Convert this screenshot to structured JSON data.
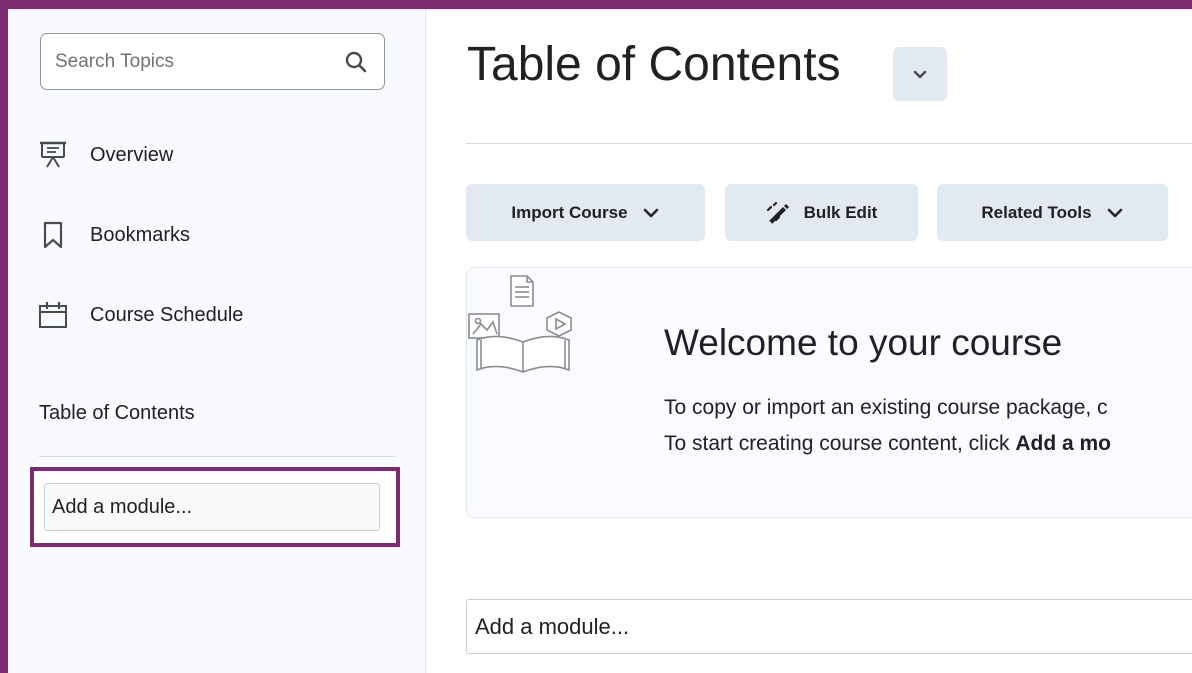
{
  "sidebar": {
    "search": {
      "placeholder": "Search Topics",
      "icon": "search-icon"
    },
    "nav": [
      {
        "label": "Overview",
        "icon": "presentation-icon"
      },
      {
        "label": "Bookmarks",
        "icon": "bookmark-icon"
      },
      {
        "label": "Course Schedule",
        "icon": "calendar-icon"
      }
    ],
    "toc_heading": "Table of Contents",
    "add_module_placeholder": "Add a module..."
  },
  "main": {
    "title": "Table of Contents",
    "toolbar": {
      "import_course": "Import Course",
      "bulk_edit": "Bulk Edit",
      "related_tools": "Related Tools"
    },
    "welcome": {
      "heading": "Welcome to your course",
      "line1": "To copy or import an existing course package, c",
      "line2_prefix": "To start creating course content, click ",
      "line2_bold": "Add a mo"
    },
    "add_module_placeholder": "Add a module..."
  },
  "colors": {
    "highlight": "#7b2b6f",
    "button_bg": "#e3e9f1",
    "sidebar_bg": "#f8fafd"
  }
}
